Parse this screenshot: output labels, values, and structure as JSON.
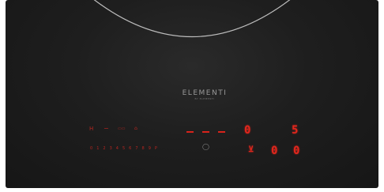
{
  "brand": {
    "name": "ELEMENTI",
    "sub": "BY ELEMENTI"
  },
  "top_controls": {
    "power": "H",
    "minus": "−",
    "zone_select": "▭▭",
    "lock": "⌂"
  },
  "dashes": [
    "-",
    "-",
    "-"
  ],
  "zone_display_left": "0",
  "zone_display_right": "5",
  "slider_levels": [
    "0",
    "1",
    "2",
    "3",
    "4",
    "5",
    "6",
    "7",
    "8",
    "9",
    "P"
  ],
  "timer_icon": "◯",
  "timer_prefix": "⊻",
  "timer_digits": [
    "0",
    "0"
  ],
  "colors": {
    "panel": "#1e1e1e",
    "led_red": "#e2261c"
  }
}
